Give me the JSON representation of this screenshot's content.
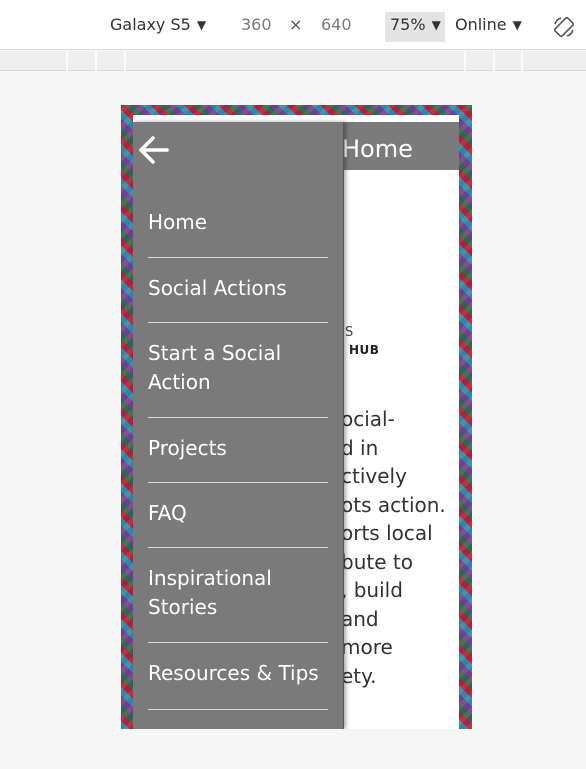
{
  "devtools": {
    "device": "Galaxy S5",
    "width": "360",
    "times": "×",
    "height": "640",
    "zoom": "75%",
    "network": "Online",
    "dropdown_glyph": "▼"
  },
  "page": {
    "header_title": "Home",
    "logo_fragment_1": "S",
    "logo_fragment_2": "HUB",
    "body_lines": [
      "ocial-",
      "d in",
      "ctively",
      "ots action.",
      "orts local",
      "bute to",
      ", build",
      "and",
      "more",
      "ety."
    ]
  },
  "drawer": {
    "items": [
      {
        "label": "Home"
      },
      {
        "label": "Social Actions"
      },
      {
        "label": "Start a Social\nAction"
      },
      {
        "label": "Projects"
      },
      {
        "label": "FAQ"
      },
      {
        "label": "Inspirational\nStories"
      },
      {
        "label": "Resources & Tips"
      }
    ]
  },
  "colors": {
    "drawer_bg": "#7a7a7a",
    "header_bg": "#7b7b7b",
    "page_bg": "#f6f6f6"
  },
  "icons": {
    "back": "arrow-left-icon",
    "rotate": "rotate-icon"
  }
}
